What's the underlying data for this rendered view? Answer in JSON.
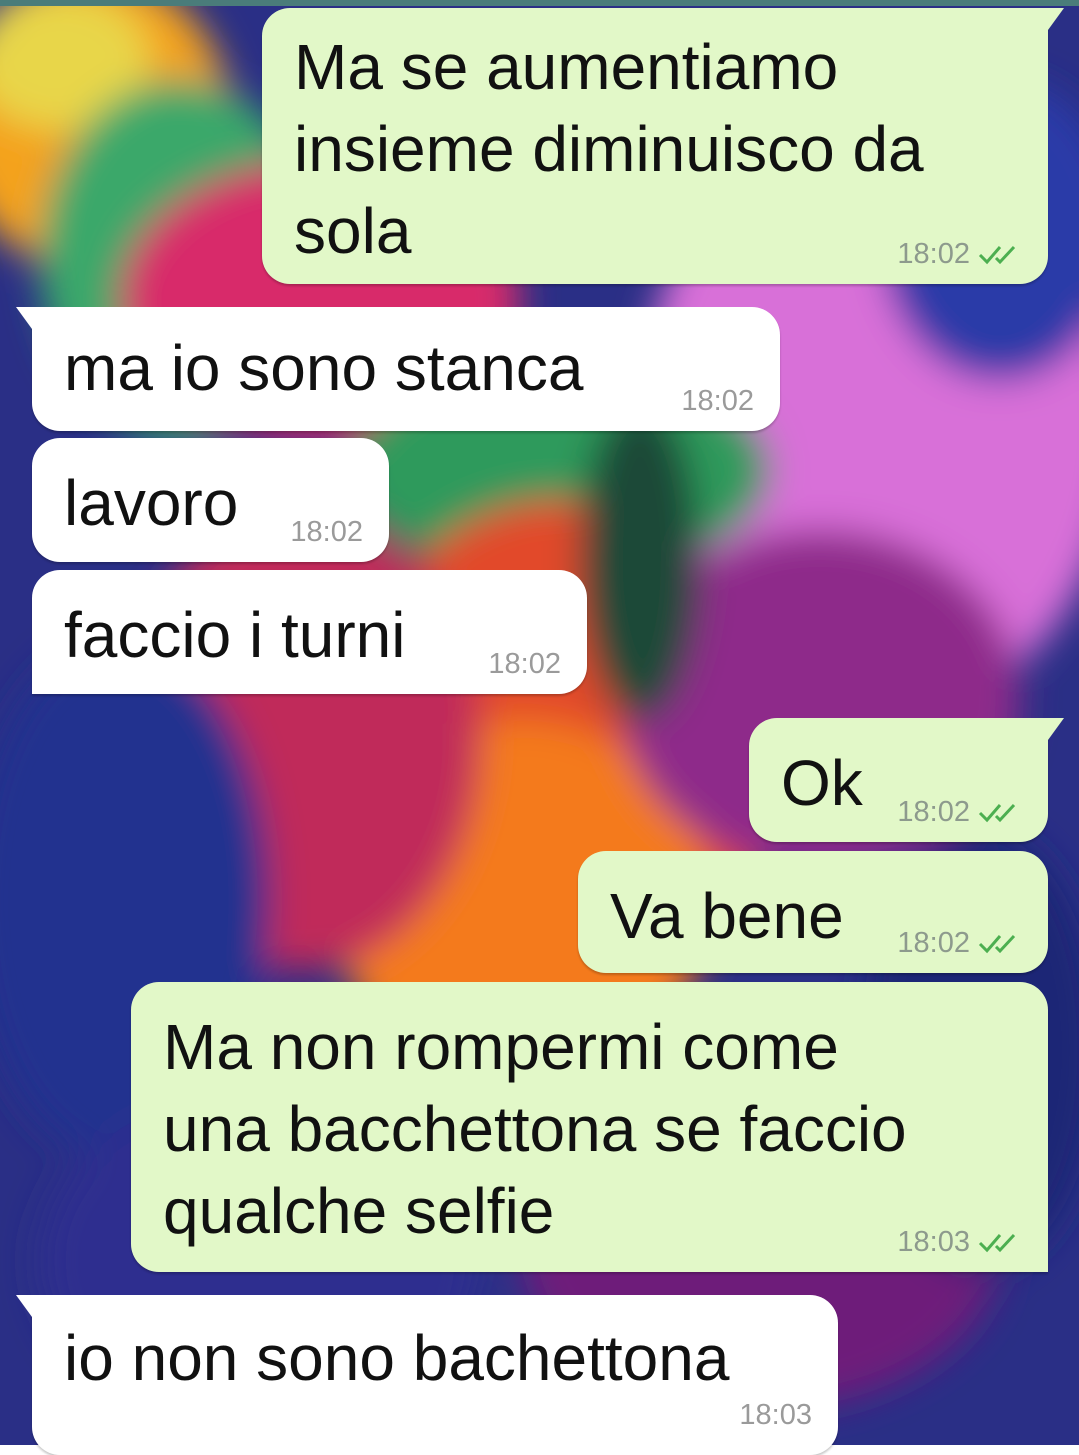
{
  "chat": {
    "messages": [
      {
        "id": "m1",
        "direction": "out",
        "text": "Ma se aumentiamo\ninsieme diminuisco da\nsola",
        "time": "18:02",
        "status_icon": "double-check-icon"
      },
      {
        "id": "m2",
        "direction": "in",
        "text": "ma io sono stanca",
        "time": "18:02"
      },
      {
        "id": "m3",
        "direction": "in",
        "text": "lavoro",
        "time": "18:02"
      },
      {
        "id": "m4",
        "direction": "in",
        "text": "faccio i turni",
        "time": "18:02"
      },
      {
        "id": "m5",
        "direction": "out",
        "text": "Ok",
        "time": "18:02",
        "status_icon": "double-check-icon"
      },
      {
        "id": "m6",
        "direction": "out",
        "text": "Va bene",
        "time": "18:02",
        "status_icon": "double-check-icon"
      },
      {
        "id": "m7",
        "direction": "out",
        "text": "Ma non rompermi come\nuna bacchettona se faccio\nqualche selfie",
        "time": "18:03",
        "status_icon": "double-check-icon"
      },
      {
        "id": "m8",
        "direction": "in",
        "text": "io non sono bachettona",
        "time": "18:03"
      }
    ]
  },
  "theme": {
    "incoming_bubble": "#ffffff",
    "outgoing_bubble": "#e2f8c8",
    "check_color": "#4caf50",
    "top_bar": "#4a7c7a"
  }
}
